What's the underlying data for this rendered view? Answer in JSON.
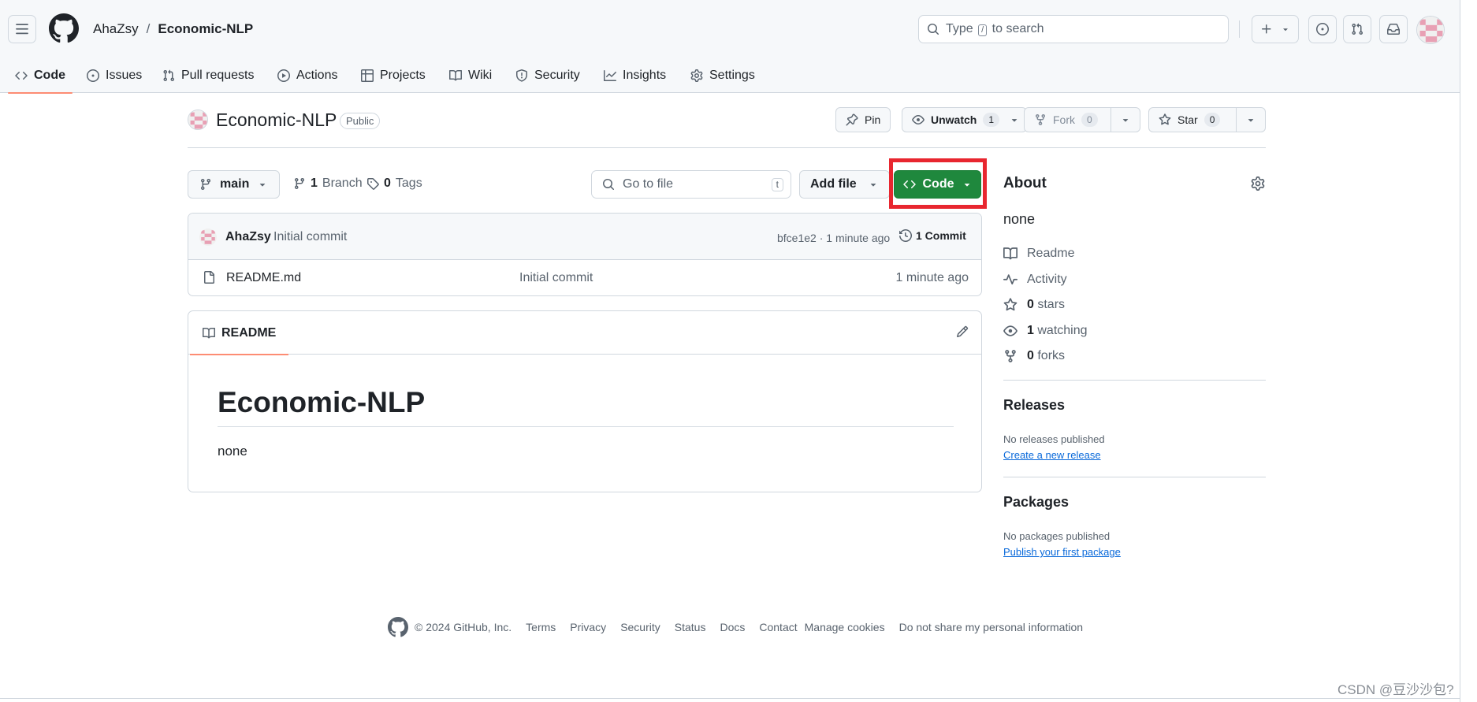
{
  "header": {
    "owner": "AhaZsy",
    "separator": "/",
    "repo": "Economic-NLP",
    "search_prefix": "Type",
    "search_key": "/",
    "search_suffix": "to search",
    "plus_label": "+"
  },
  "nav": {
    "items": [
      {
        "label": "Code",
        "icon": "code-icon",
        "active": true
      },
      {
        "label": "Issues",
        "icon": "issue-opened-icon"
      },
      {
        "label": "Pull requests",
        "icon": "git-pull-request-icon"
      },
      {
        "label": "Actions",
        "icon": "play-icon"
      },
      {
        "label": "Projects",
        "icon": "table-icon"
      },
      {
        "label": "Wiki",
        "icon": "book-icon"
      },
      {
        "label": "Security",
        "icon": "shield-icon"
      },
      {
        "label": "Insights",
        "icon": "graph-icon"
      },
      {
        "label": "Settings",
        "icon": "gear-icon"
      }
    ]
  },
  "repo_header": {
    "title": "Economic-NLP",
    "visibility": "Public",
    "pin_label": "Pin",
    "watch_label": "Unwatch",
    "watch_count": "1",
    "fork_label": "Fork",
    "fork_count": "0",
    "star_label": "Star",
    "star_count": "0"
  },
  "toolbar": {
    "branch": "main",
    "branch_count": "1",
    "branch_label": "Branch",
    "tag_count": "0",
    "tag_label": "Tags",
    "goto_placeholder": "Go to file",
    "goto_key": "t",
    "add_file_label": "Add file",
    "code_label": "Code"
  },
  "latest_commit": {
    "author": "AhaZsy",
    "message": "Initial commit",
    "meta": "bfce1e2 · 1 minute ago",
    "count_label": "1 Commit"
  },
  "files": [
    {
      "name": "README.md",
      "message": "Initial commit",
      "time": "1 minute ago"
    }
  ],
  "readme": {
    "tab_label": "README",
    "heading": "Economic-NLP",
    "body": "none"
  },
  "about": {
    "title": "About",
    "description": "none",
    "readme_label": "Readme",
    "activity_label": "Activity",
    "stars_count": "0",
    "stars_label": "stars",
    "watching_count": "1",
    "watching_label": "watching",
    "forks_count": "0",
    "forks_label": "forks"
  },
  "releases": {
    "title": "Releases",
    "note": "No releases published",
    "link": "Create a new release"
  },
  "packages": {
    "title": "Packages",
    "note": "No packages published",
    "link": "Publish your first package"
  },
  "footer": {
    "copyright": "© 2024 GitHub, Inc.",
    "links": [
      "Terms",
      "Privacy",
      "Security",
      "Status",
      "Docs",
      "Contact",
      "Manage cookies",
      "Do not share my personal information"
    ]
  },
  "watermark": "CSDN @豆沙沙包?",
  "colors": {
    "accent_green": "#1f883d",
    "highlight_red": "#e8262f",
    "tab_underline": "#fd8c73",
    "link_blue": "#0969da"
  }
}
